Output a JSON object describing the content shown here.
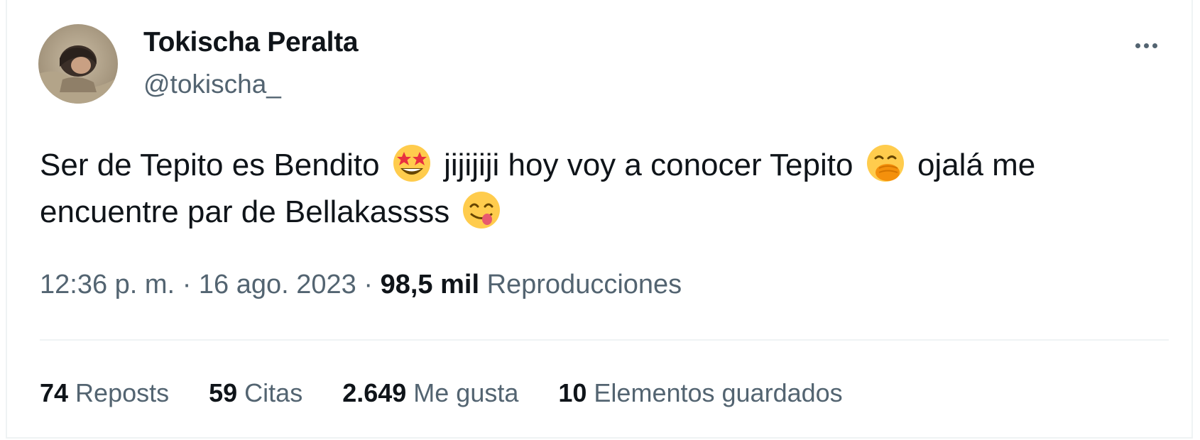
{
  "author": {
    "display_name": "Tokischa Peralta",
    "handle": "@tokischa_",
    "avatar": "profile-photo"
  },
  "menu": {
    "icon": "more-horizontal-icon"
  },
  "tweet": {
    "segments": [
      "Ser de Tepito es Bendito",
      "jijijiji hoy voy a conocer Tepito",
      "ojalá me",
      "encuentre par de Bellakassss"
    ],
    "emojis": [
      "star-struck-emoji",
      "face-with-hand-over-mouth-emoji",
      "face-savoring-food-emoji"
    ]
  },
  "meta": {
    "time": "12:36 p. m.",
    "separator": "·",
    "date": "16 ago. 2023",
    "views_count": "98,5 mil",
    "views_label": "Reproducciones"
  },
  "stats": {
    "reposts": {
      "count": "74",
      "label": "Reposts"
    },
    "quotes": {
      "count": "59",
      "label": "Citas"
    },
    "likes": {
      "count": "2.649",
      "label": "Me gusta"
    },
    "bookmarks": {
      "count": "10",
      "label": "Elementos guardados"
    }
  },
  "colors": {
    "primary_text": "#0f1419",
    "secondary_text": "#536471",
    "divider": "#eff3f4"
  }
}
